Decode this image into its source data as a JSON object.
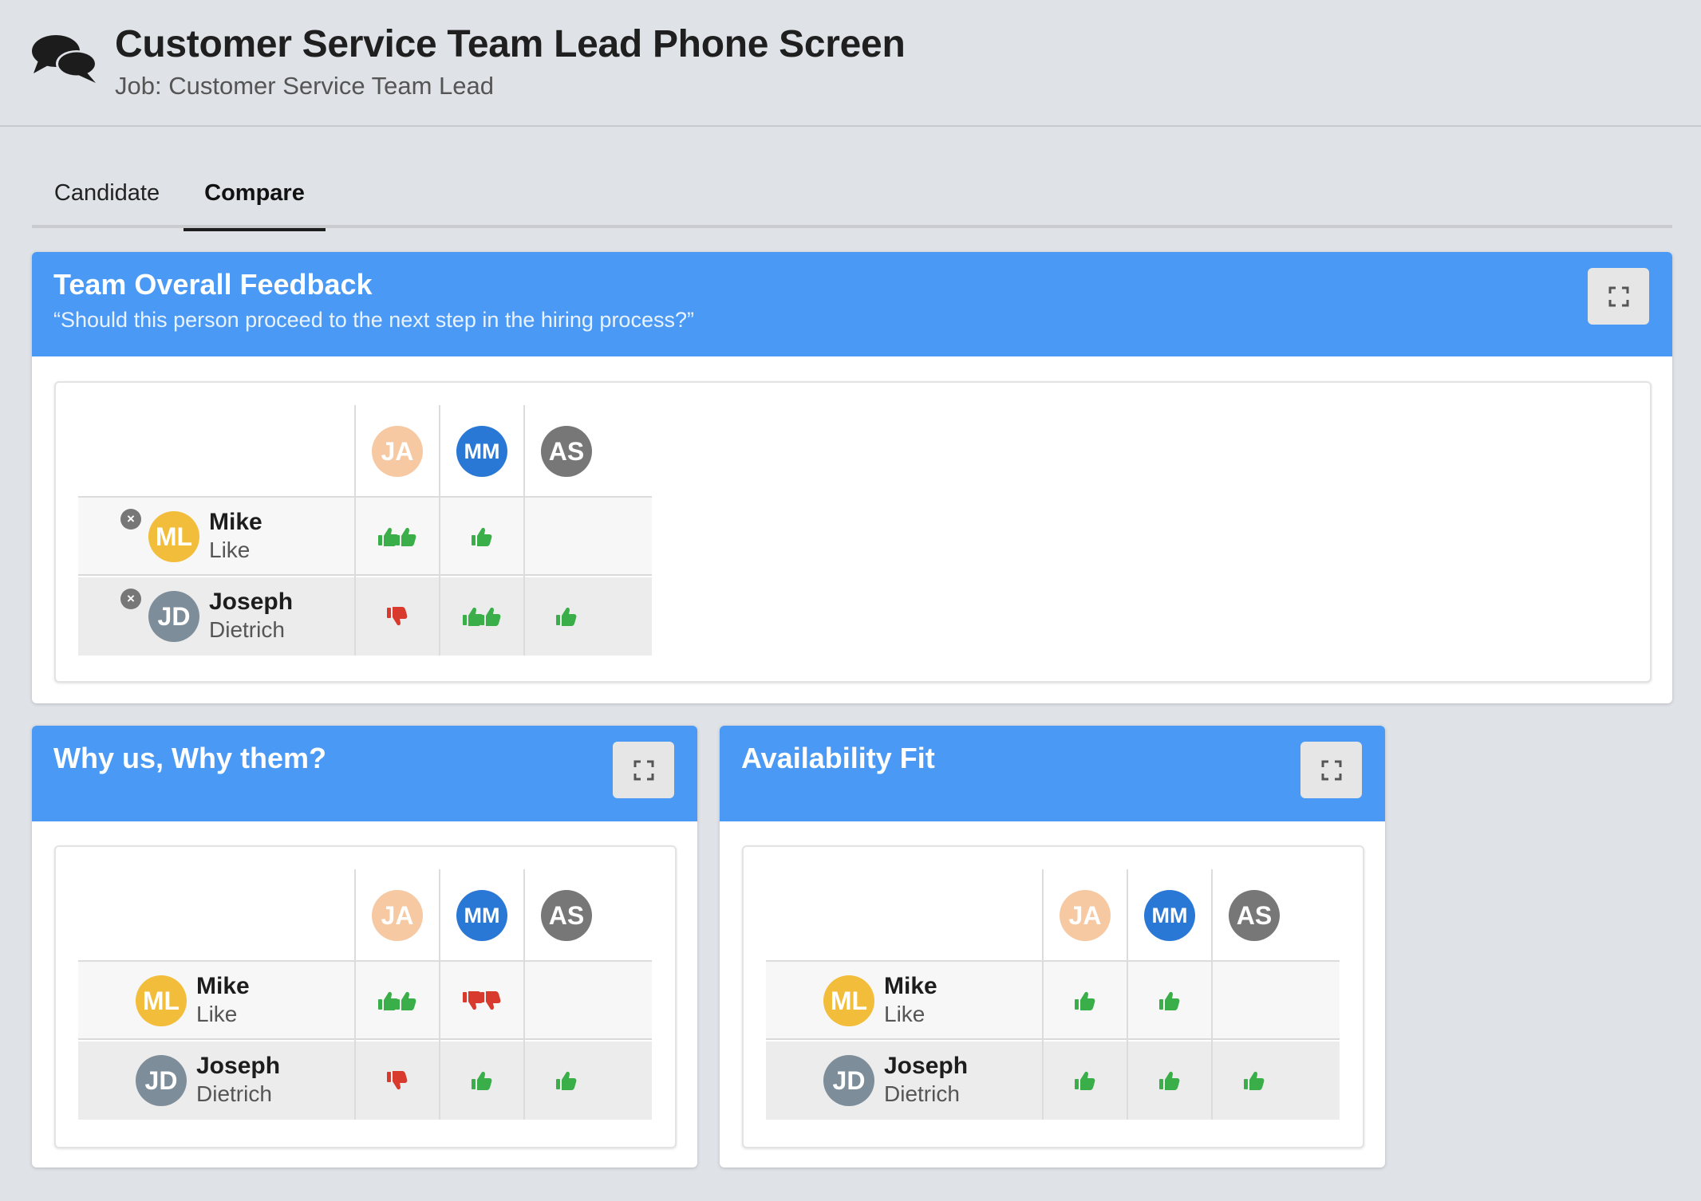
{
  "header": {
    "title": "Customer Service Team Lead Phone Screen",
    "subtitle": "Job: Customer Service Team Lead",
    "icon": "chat-bubbles-icon"
  },
  "tabs": [
    {
      "label": "Candidate",
      "active": false
    },
    {
      "label": "Compare",
      "active": true
    }
  ],
  "colors": {
    "accent": "#4a9af5",
    "like": "#3aae49",
    "dislike": "#d83b2e",
    "avatar_ja": "#f6c9a2",
    "avatar_mm": "#2a78d6",
    "avatar_as": "#777777",
    "avatar_ml": "#f3bd3c",
    "avatar_jd": "#7d8d9a"
  },
  "reviewers": [
    {
      "initials": "JA"
    },
    {
      "initials": "MM"
    },
    {
      "initials": "AS"
    }
  ],
  "candidates": [
    {
      "initials": "ML",
      "first": "Mike",
      "last": "Like"
    },
    {
      "initials": "JD",
      "first": "Joseph",
      "last": "Dietrich"
    }
  ],
  "panels": [
    {
      "title": "Team Overall Feedback",
      "subtitle": "“Should this person proceed to the next step in the hiring process?”",
      "votes": [
        [
          "strong-yes",
          "yes",
          "none"
        ],
        [
          "no",
          "strong-yes",
          "yes"
        ]
      ]
    },
    {
      "title": "Why us, Why them?",
      "votes": [
        [
          "strong-yes",
          "strong-no",
          "none"
        ],
        [
          "no",
          "yes",
          "yes"
        ]
      ]
    },
    {
      "title": "Availability Fit",
      "votes": [
        [
          "yes",
          "yes",
          "none"
        ],
        [
          "yes",
          "yes",
          "yes"
        ]
      ]
    }
  ]
}
